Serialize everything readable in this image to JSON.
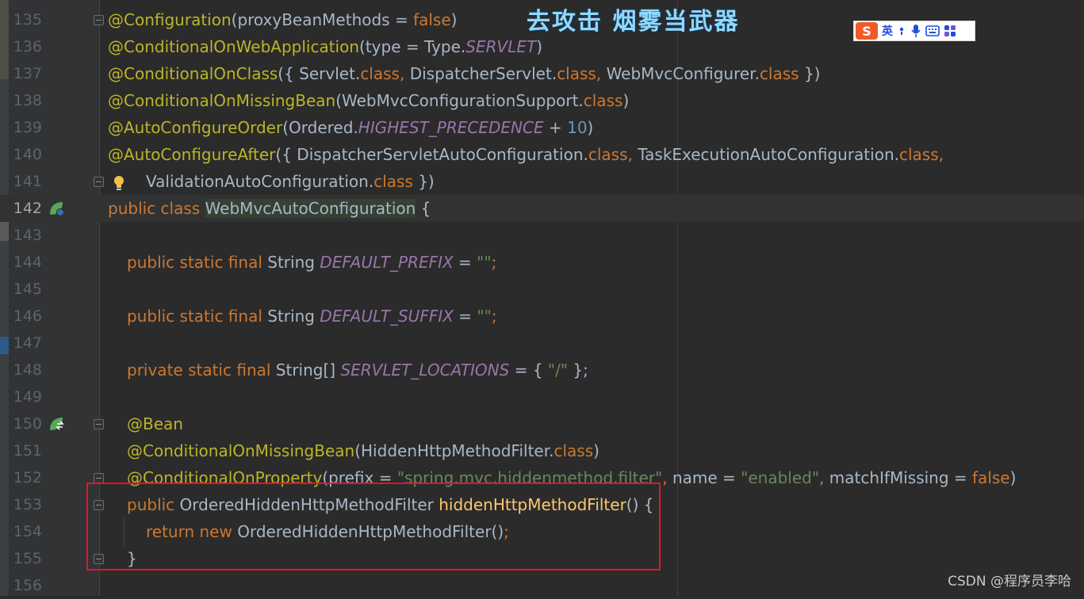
{
  "lines": [
    {
      "num": "135",
      "tokens": [
        {
          "t": "@Configuration",
          "c": "ann"
        },
        {
          "t": "(proxyBeanMethods = ",
          "c": "typ"
        },
        {
          "t": "false",
          "c": "kw"
        },
        {
          "t": ")",
          "c": "typ"
        }
      ]
    },
    {
      "num": "136",
      "tokens": [
        {
          "t": "@ConditionalOnWebApplication",
          "c": "ann"
        },
        {
          "t": "(type = Type.",
          "c": "typ"
        },
        {
          "t": "SERVLET",
          "c": "con"
        },
        {
          "t": ")",
          "c": "typ"
        }
      ]
    },
    {
      "num": "137",
      "tokens": [
        {
          "t": "@ConditionalOnClass",
          "c": "ann"
        },
        {
          "t": "({ Servlet.",
          "c": "typ"
        },
        {
          "t": "class",
          "c": "kw"
        },
        {
          "t": ", ",
          "c": "kw"
        },
        {
          "t": "DispatcherServlet.",
          "c": "typ"
        },
        {
          "t": "class",
          "c": "kw"
        },
        {
          "t": ", ",
          "c": "kw"
        },
        {
          "t": "WebMvcConfigurer.",
          "c": "typ"
        },
        {
          "t": "class",
          "c": "kw"
        },
        {
          "t": " })",
          "c": "typ"
        }
      ]
    },
    {
      "num": "138",
      "tokens": [
        {
          "t": "@ConditionalOnMissingBean",
          "c": "ann"
        },
        {
          "t": "(WebMvcConfigurationSupport.",
          "c": "typ"
        },
        {
          "t": "class",
          "c": "kw"
        },
        {
          "t": ")",
          "c": "typ"
        }
      ]
    },
    {
      "num": "139",
      "tokens": [
        {
          "t": "@AutoConfigureOrder",
          "c": "ann"
        },
        {
          "t": "(Ordered.",
          "c": "typ"
        },
        {
          "t": "HIGHEST_PRECEDENCE",
          "c": "con"
        },
        {
          "t": " + ",
          "c": "typ"
        },
        {
          "t": "10",
          "c": "num"
        },
        {
          "t": ")",
          "c": "typ"
        }
      ]
    },
    {
      "num": "140",
      "tokens": [
        {
          "t": "@AutoConfigureAfter",
          "c": "ann"
        },
        {
          "t": "({ DispatcherServletAutoConfiguration.",
          "c": "typ"
        },
        {
          "t": "class",
          "c": "kw"
        },
        {
          "t": ", ",
          "c": "kw"
        },
        {
          "t": "TaskExecutionAutoConfiguration.",
          "c": "typ"
        },
        {
          "t": "class",
          "c": "kw"
        },
        {
          "t": ",",
          "c": "kw"
        }
      ]
    },
    {
      "num": "141",
      "indent": 2,
      "tokens": [
        {
          "t": "ValidationAutoConfiguration.",
          "c": "typ"
        },
        {
          "t": "class",
          "c": "kw"
        },
        {
          "t": " })",
          "c": "typ"
        }
      ]
    },
    {
      "num": "142",
      "current": true,
      "tokens": [
        {
          "t": "public class ",
          "c": "kw"
        },
        {
          "t": "WebMvcAutoConfiguration",
          "c": "typ cls-hl"
        },
        {
          "t": " {",
          "c": "typ"
        }
      ]
    },
    {
      "num": "143",
      "tokens": []
    },
    {
      "num": "144",
      "indent": 1,
      "tokens": [
        {
          "t": "public static final ",
          "c": "kw"
        },
        {
          "t": "String ",
          "c": "typ"
        },
        {
          "t": "DEFAULT_PREFIX",
          "c": "con"
        },
        {
          "t": " = ",
          "c": "typ"
        },
        {
          "t": "\"\"",
          "c": "str"
        },
        {
          "t": ";",
          "c": "kw"
        }
      ]
    },
    {
      "num": "145",
      "tokens": []
    },
    {
      "num": "146",
      "indent": 1,
      "tokens": [
        {
          "t": "public static final ",
          "c": "kw"
        },
        {
          "t": "String ",
          "c": "typ"
        },
        {
          "t": "DEFAULT_SUFFIX",
          "c": "con"
        },
        {
          "t": " = ",
          "c": "typ"
        },
        {
          "t": "\"\"",
          "c": "str"
        },
        {
          "t": ";",
          "c": "kw"
        }
      ]
    },
    {
      "num": "147",
      "tokens": []
    },
    {
      "num": "148",
      "indent": 1,
      "tokens": [
        {
          "t": "private static final ",
          "c": "kw"
        },
        {
          "t": "String[] ",
          "c": "typ"
        },
        {
          "t": "SERVLET_LOCATIONS",
          "c": "con"
        },
        {
          "t": " = { ",
          "c": "typ"
        },
        {
          "t": "\"/\"",
          "c": "str"
        },
        {
          "t": " };",
          "c": "typ"
        }
      ]
    },
    {
      "num": "149",
      "tokens": []
    },
    {
      "num": "150",
      "indent": 1,
      "tokens": [
        {
          "t": "@Bean",
          "c": "ann"
        }
      ]
    },
    {
      "num": "151",
      "indent": 1,
      "tokens": [
        {
          "t": "@ConditionalOnMissingBean",
          "c": "ann"
        },
        {
          "t": "(HiddenHttpMethodFilter.",
          "c": "typ"
        },
        {
          "t": "class",
          "c": "kw"
        },
        {
          "t": ")",
          "c": "typ"
        }
      ]
    },
    {
      "num": "152",
      "indent": 1,
      "tokens": [
        {
          "t": "@ConditionalOnProperty",
          "c": "ann"
        },
        {
          "t": "(prefix = ",
          "c": "typ"
        },
        {
          "t": "\"spring.mvc.hiddenmethod.filter\"",
          "c": "str"
        },
        {
          "t": ", ",
          "c": "kw"
        },
        {
          "t": "name = ",
          "c": "typ"
        },
        {
          "t": "\"enabled\"",
          "c": "str"
        },
        {
          "t": ", ",
          "c": "kw"
        },
        {
          "t": "matchIfMissing = ",
          "c": "typ"
        },
        {
          "t": "false",
          "c": "kw"
        },
        {
          "t": ")",
          "c": "typ"
        }
      ]
    },
    {
      "num": "153",
      "indent": 1,
      "tokens": [
        {
          "t": "public ",
          "c": "kw"
        },
        {
          "t": "OrderedHiddenHttpMethodFilter ",
          "c": "typ"
        },
        {
          "t": "hiddenHttpMethodFilter",
          "c": "meth"
        },
        {
          "t": "() {",
          "c": "typ"
        }
      ]
    },
    {
      "num": "154",
      "indent": 2,
      "tokens": [
        {
          "t": "return new ",
          "c": "kw"
        },
        {
          "t": "OrderedHiddenHttpMethodFilter()",
          "c": "typ"
        },
        {
          "t": ";",
          "c": "kw"
        }
      ]
    },
    {
      "num": "155",
      "indent": 1,
      "tokens": [
        {
          "t": "}",
          "c": "typ"
        }
      ]
    },
    {
      "num": "156",
      "tokens": []
    }
  ],
  "overlay_title": "去攻击  烟雾当武器",
  "ime_toolbar": {
    "lang_label": "英",
    "icons": [
      "sogou-logo-icon",
      "punctuation-icon",
      "microphone-icon",
      "keyboard-icon",
      "apps-grid-icon"
    ]
  },
  "watermark": "CSDN @程序员李哈",
  "colors": {
    "annotation": "#bbb529",
    "keyword": "#cc7832",
    "constant": "#9876aa",
    "string": "#6a8759",
    "number": "#6897bb",
    "method": "#ffc66d",
    "highlight_box": "#e8112d"
  }
}
